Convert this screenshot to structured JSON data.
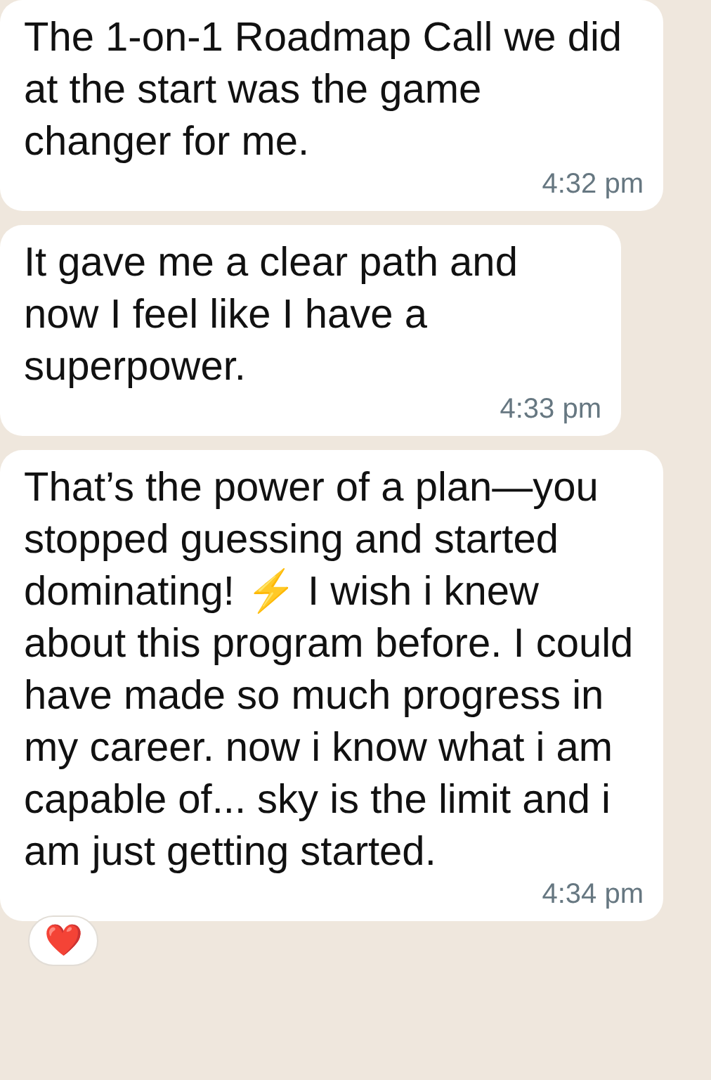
{
  "messages": [
    {
      "text": "The 1-on-1 Roadmap Call we did at the start was the game changer for me.",
      "time": "4:32 pm"
    },
    {
      "text": "It gave me a clear path and now I feel like I have a superpower.",
      "time": "4:33 pm"
    },
    {
      "text": "That’s the power of a plan—you stopped guessing and started dominating! ⚡ I wish i knew about this program before. I could have made so much progress in my career. now i know what i am capable of... sky is the limit and i am just getting started.",
      "time": "4:34 pm",
      "reaction": "❤️"
    }
  ]
}
